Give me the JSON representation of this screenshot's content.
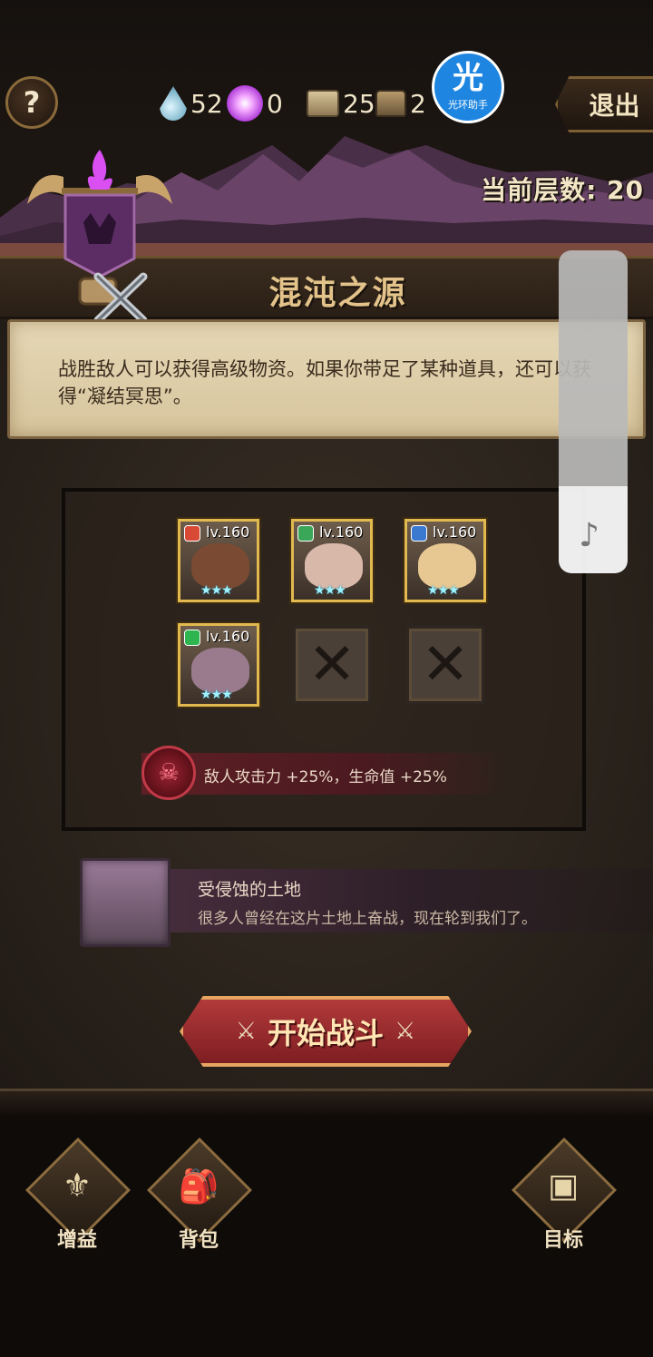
{
  "resources": {
    "water": "52",
    "orb": "0",
    "scroll": "25",
    "chest": "2"
  },
  "helper": {
    "icon_char": "光",
    "label": "光环助手"
  },
  "header": {
    "help_icon": "?",
    "exit_label": "退出",
    "floor_label": "当前层数:",
    "floor_value": "20"
  },
  "stage": {
    "title": "混沌之源",
    "description": "战胜敌人可以获得高级物资。如果你带足了某种道具，还可以获得“凝结冥思”。"
  },
  "team": {
    "heroes": [
      {
        "level": "lv.160",
        "element_color": "#d94a36",
        "stars": "★★★"
      },
      {
        "level": "lv.160",
        "element_color": "#3aa657",
        "stars": "★★★"
      },
      {
        "level": "lv.160",
        "element_color": "#3b79d1",
        "stars": "★★★"
      },
      {
        "level": "lv.160",
        "element_color": "#2eb54f",
        "stars": "★★★"
      }
    ],
    "empty_slot_icon": "✕"
  },
  "buff": {
    "text": "敌人攻击力 +25%，生命值 +25%"
  },
  "land": {
    "title": "受侵蚀的土地",
    "description": "很多人曾经在这片土地上奋战，现在轮到我们了。"
  },
  "start_button": {
    "label": "开始战斗"
  },
  "bottom_nav": [
    {
      "label": "增益",
      "icon": "buff-icon"
    },
    {
      "label": "背包",
      "icon": "backpack-icon"
    },
    {
      "label": "目标",
      "icon": "target-chest-icon"
    }
  ],
  "colors": {
    "gold": "#e2b94f",
    "accent_red": "#b23a3a",
    "ruins_purple": "#5a3a58"
  }
}
